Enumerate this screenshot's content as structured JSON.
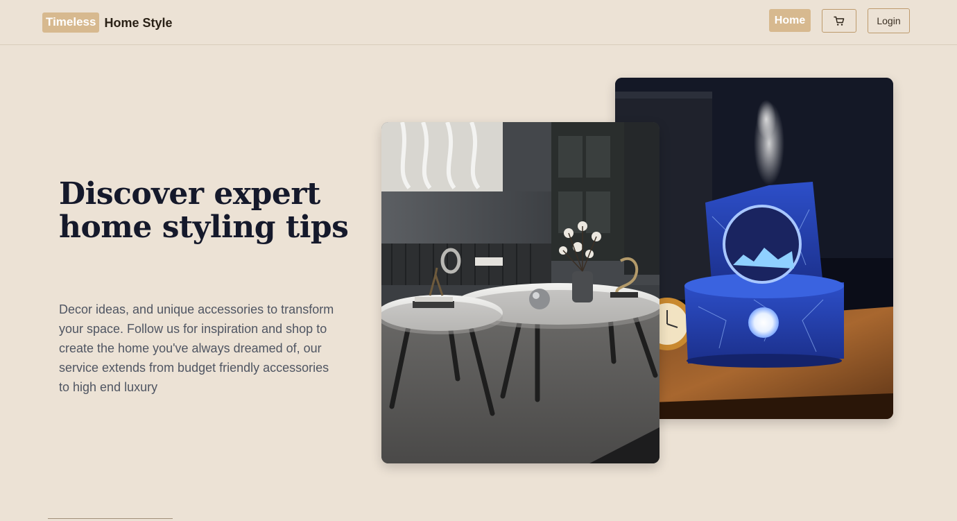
{
  "header": {
    "brand_badge": "Timeless",
    "brand_name": "Home Style",
    "nav": {
      "home_label": "Home",
      "cart_icon": "cart-icon",
      "login_label": "Login"
    }
  },
  "hero": {
    "title": "Discover expert home styling tips",
    "description": "Decor ideas, and unique accessories to transform your space. Follow us for inspiration and shop to create the home you've always dreamed of, our service extends from budget friendly accessories to high end luxury"
  },
  "images": {
    "back": "humidifier-photo",
    "front": "coffee-tables-photo"
  },
  "colors": {
    "background": "#ece2d5",
    "accent": "#d7b98f",
    "heading": "#15192b",
    "body_text": "#4f5562"
  }
}
